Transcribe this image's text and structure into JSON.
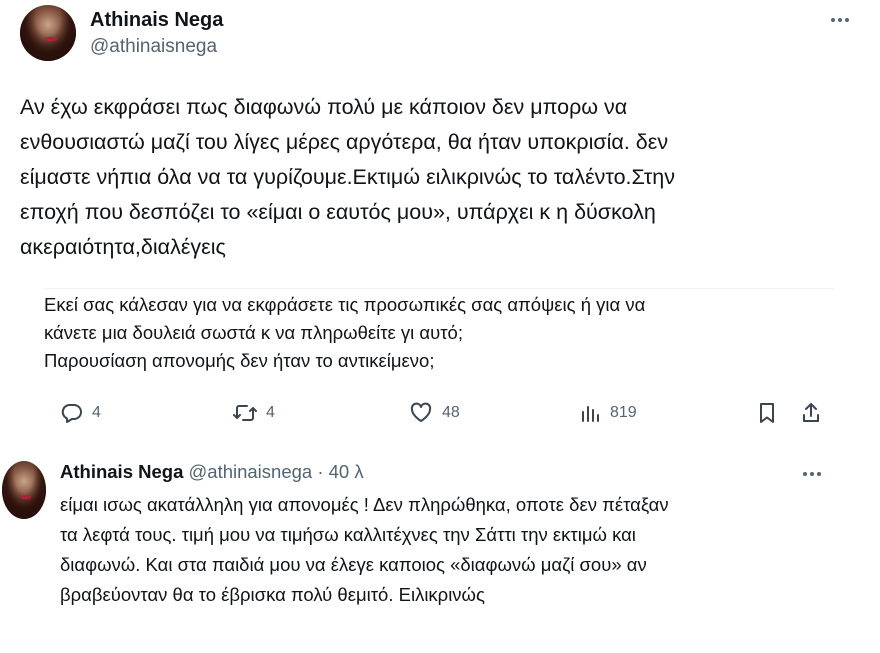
{
  "main_tweet": {
    "author_name": "Athinais Nega",
    "author_handle": "@athinaisnega",
    "text": "Αν έχω εκφράσει πως διαφωνώ πολύ με κάποιον δεν μπορω να\nενθουσιαστώ  μαζί του λίγες μέρες αργότερα, θα ήταν υποκρισία. δεν\nείμαστε νήπια όλα να τα γυρίζουμε.Εκτιμώ ειλικρινώς το ταλέντο.Στην\nεποχή που δεσπόζει το «είμαι ο εαυτός μου», υπάρχει κ η δύσκολη\nακεραιότητα,διαλέγεις"
  },
  "quoted": {
    "text": "Εκεί σας κάλεσαν για να εκφράσετε τις προσωπικές σας απόψεις ή για να\nκάνετε μια δουλειά σωστά κ να πληρωθείτε γι αυτό;\nΠαρουσίαση απονομής δεν ήταν το αντικείμενο;"
  },
  "actions": {
    "replies": "4",
    "retweets": "4",
    "likes": "48",
    "views": "819"
  },
  "reply": {
    "author_name": "Athinais Nega",
    "author_handle": "@athinaisnega · 40 λ",
    "text": "είμαι ισως ακατάλληλη για απονομές ! Δεν πληρώθηκα, οποτε δεν πέταξαν\nτα λεφτά τους. τιμή μου να τιμήσω καλλιτέχνες την Σάττι την εκτιμώ και\nδιαφωνώ. Και στα παιδιά μου να έλεγε καποιος «διαφωνώ μαζί σου» αν\nβραβεύονταν θα το έβρισκα πολύ θεμιτό. Ειλικρινώς"
  },
  "colors": {
    "text": "#0f1419",
    "secondary": "#536471",
    "divider": "#eff3f4"
  }
}
